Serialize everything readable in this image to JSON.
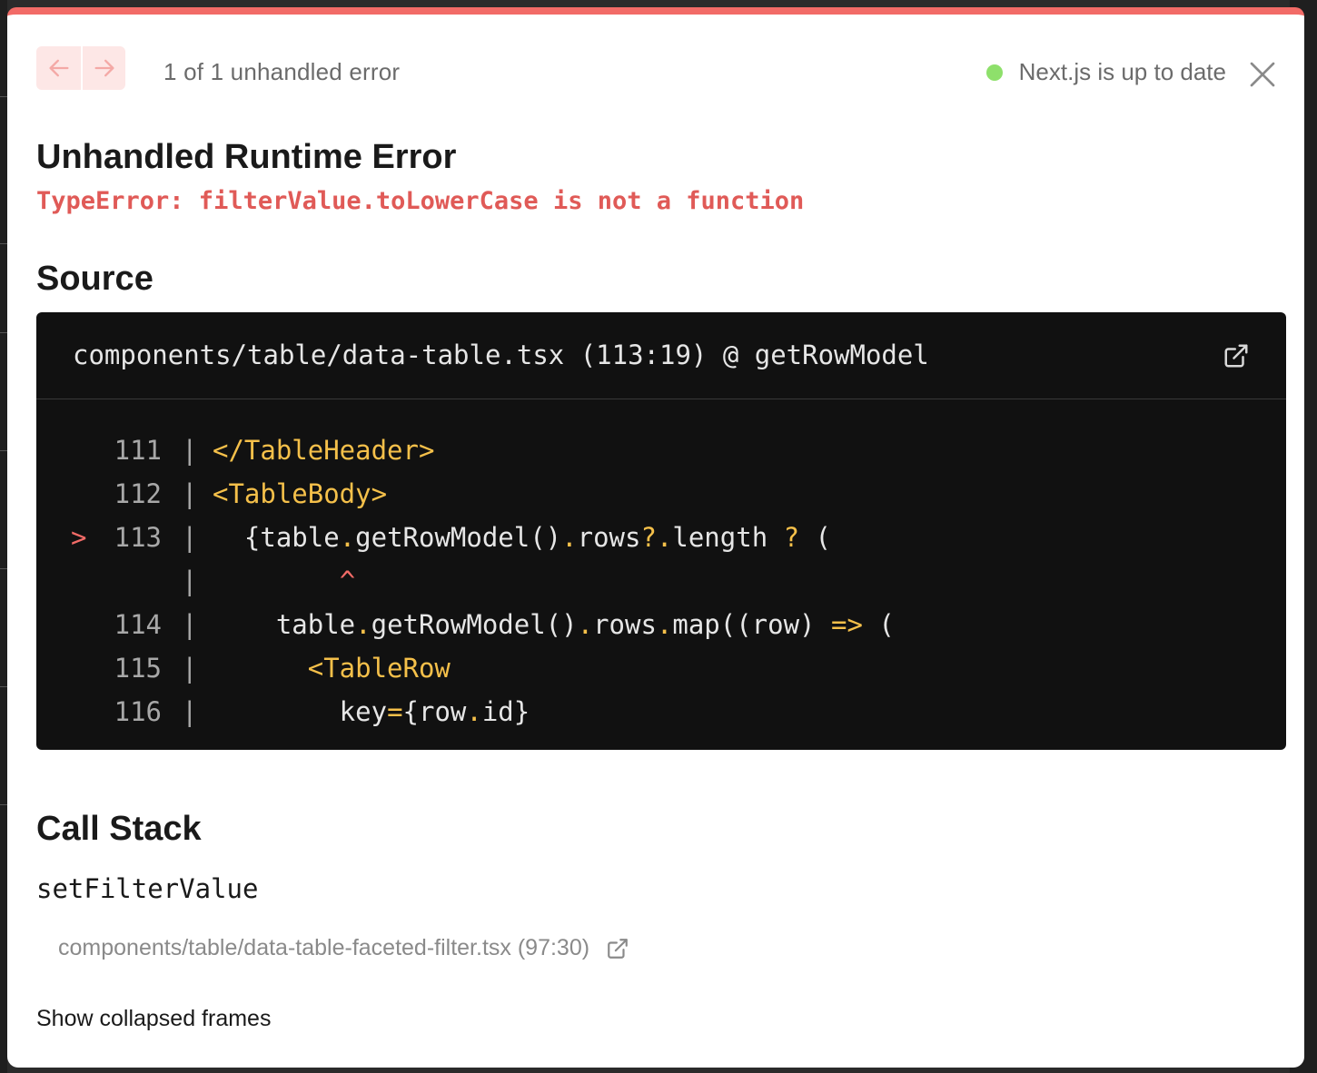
{
  "toolbar": {
    "count_text": "1 of 1 unhandled error",
    "status_text": "Next.js is up to date"
  },
  "error": {
    "title": "Unhandled Runtime Error",
    "message": "TypeError: filterValue.toLowerCase is not a function"
  },
  "source": {
    "heading": "Source",
    "file": "components/table/data-table.tsx (113:19) @ getRowModel",
    "lines": [
      {
        "marker": "",
        "ln": "111",
        "code": "</TableHeader>"
      },
      {
        "marker": "",
        "ln": "112",
        "code": "<TableBody>"
      },
      {
        "marker": ">",
        "ln": "113",
        "code": "  {table.getRowModel().rows?.length ? ("
      },
      {
        "marker": "",
        "ln": "",
        "code": "        ^"
      },
      {
        "marker": "",
        "ln": "114",
        "code": "    table.getRowModel().rows.map((row) => ("
      },
      {
        "marker": "",
        "ln": "115",
        "code": "      <TableRow"
      },
      {
        "marker": "",
        "ln": "116",
        "code": "        key={row.id}"
      }
    ]
  },
  "call_stack": {
    "heading": "Call Stack",
    "function_name": "setFilterValue",
    "location": "components/table/data-table-faceted-filter.tsx (97:30)",
    "show_collapsed": "Show collapsed frames"
  },
  "colors": {
    "accent_red": "#f26b67",
    "error_text": "#e05a57",
    "status_green": "#8ee06b",
    "code_bg": "#111111",
    "code_keyword": "#f5c04a"
  },
  "icons": {
    "prev": "arrow-left-icon",
    "next": "arrow-right-icon",
    "close": "close-icon",
    "external": "external-link-icon"
  }
}
